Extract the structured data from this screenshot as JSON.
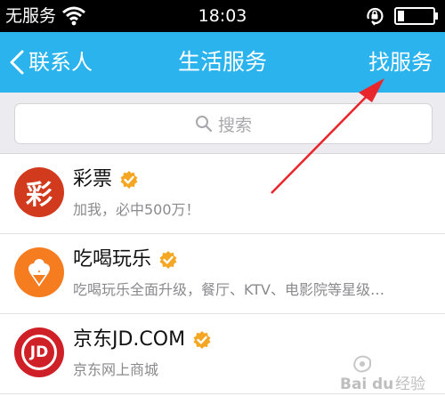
{
  "status": {
    "carrier": "无服务",
    "time": "18:03"
  },
  "nav": {
    "back_label": "联系人",
    "title": "生活服务",
    "action_label": "找服务"
  },
  "search": {
    "placeholder": "搜索"
  },
  "items": [
    {
      "name": "彩票",
      "desc": "加我，必中500万！",
      "avatar_text": "彩",
      "avatar_color": "#d23a1e"
    },
    {
      "name": "吃喝玩乐",
      "desc": "吃喝玩乐全面升级，餐厅、KTV、电影院等星级…",
      "avatar_color": "#f57c1f"
    },
    {
      "name": "京东JD.COM",
      "desc": "京东网上商城",
      "avatar_text": "JD",
      "avatar_color": "#cf2027"
    }
  ],
  "colors": {
    "nav": "#2ab3ed",
    "verified": "#f5a623",
    "arrow": "#e8262c"
  },
  "watermark": {
    "text": "Baidu经验"
  }
}
